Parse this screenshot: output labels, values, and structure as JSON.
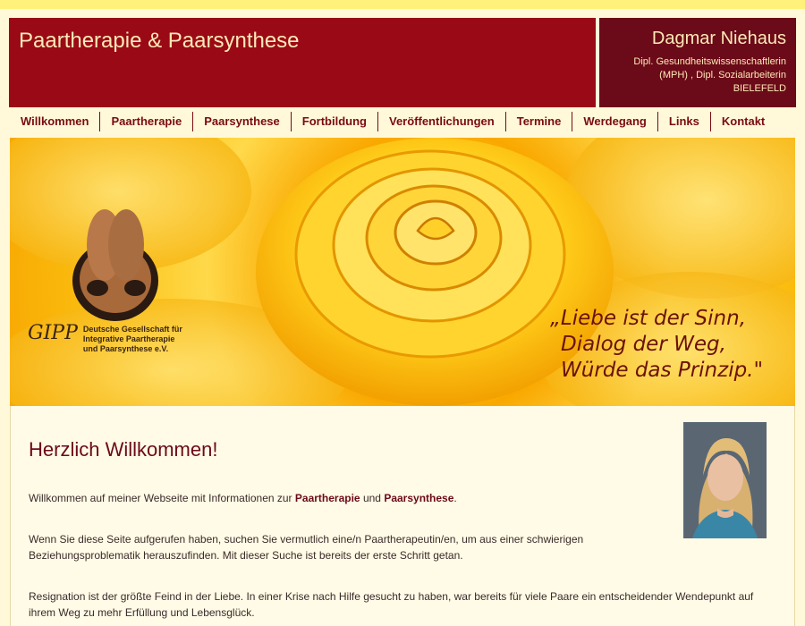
{
  "header": {
    "site_title": "Paartherapie & Paarsynthese",
    "owner_name": "Dagmar Niehaus",
    "owner_line1": "Dipl. Gesundheitswissenschaftlerin",
    "owner_line2": "(MPH) , Dipl. Sozialarbeiterin",
    "owner_city": "BIELEFELD"
  },
  "nav": {
    "items": [
      "Willkommen",
      "Paartherapie",
      "Paarsynthese",
      "Fortbildung",
      "Veröffentlichungen",
      "Termine",
      "Werdegang",
      "Links",
      "Kontakt"
    ]
  },
  "banner": {
    "logo_abbr": "GIPP",
    "logo_line1": "Deutsche Gesellschaft für",
    "logo_line2": "Integrative Paartherapie",
    "logo_line3": "und Paarsynthese e.V.",
    "quote_line1": "„Liebe ist der Sinn,",
    "quote_line2": "Dialog der Weg,",
    "quote_line3": "Würde das Prinzip.\""
  },
  "main": {
    "title": "Herzlich Willkommen!",
    "p1_text": "Willkommen auf meiner Webseite mit Informationen zur",
    "p1_link1": "Paartherapie",
    "p1_and": "und",
    "p1_link2": "Paarsynthese",
    "p1_end": ".",
    "p2_line1": "Wenn Sie diese Seite aufgerufen haben, suchen Sie vermutlich eine/n Paartherapeutin/en, um aus einer schwierigen",
    "p2_line2": "Beziehungsproblematik herauszufinden. Mit dieser Suche ist bereits der erste Schritt getan.",
    "p3_line1": "Resignation ist der größte Feind in der Liebe. In einer Krise nach Hilfe gesucht zu haben, war bereits für viele Paare ein entscheidender Wendepunkt auf",
    "p3_line2": "ihrem Weg zu mehr Erfüllung und Lebensglück."
  },
  "colors": {
    "header_red": "#9a0a16",
    "header_dark": "#6b0a18",
    "background": "#fff9d9",
    "rose_yellow": "#ffc000"
  }
}
